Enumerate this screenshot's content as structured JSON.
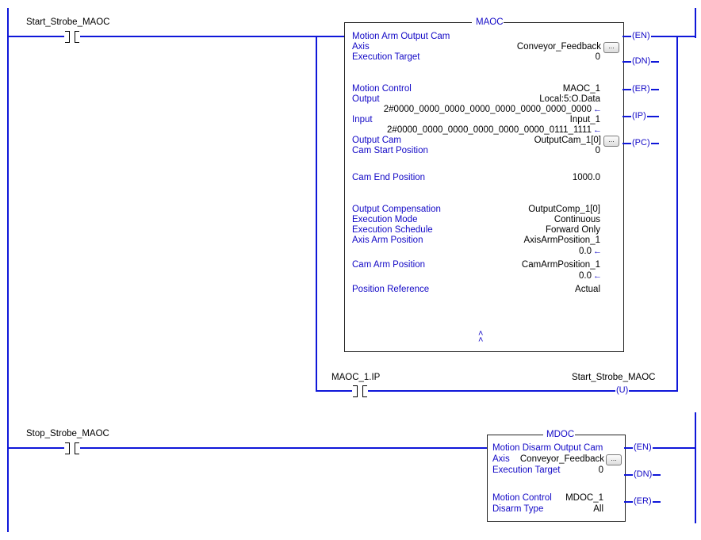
{
  "rung1": {
    "contact_tag": "Start_Strobe_MAOC",
    "branch_contact_tag": "MAOC_1.IP",
    "coil_tag": "Start_Strobe_MAOC",
    "coil_symbol": "U",
    "block": {
      "name": "MAOC",
      "description": "Motion Arm Output Cam",
      "rows": [
        {
          "label": "Axis",
          "value": "Conveyor_Feedback",
          "browse": true
        },
        {
          "label": "Execution Target",
          "value": "0"
        },
        {
          "label": "Motion Control",
          "value": "MAOC_1"
        },
        {
          "label": "Output",
          "value": "Local:5:O.Data"
        },
        {
          "label": "",
          "value": "2#0000_0000_0000_0000_0000_0000_0000_0000",
          "arrow": true
        },
        {
          "label": "Input",
          "value": "Input_1"
        },
        {
          "label": "",
          "value": "2#0000_0000_0000_0000_0000_0000_0111_1111",
          "arrow": true
        },
        {
          "label": "Output Cam",
          "value": "OutputCam_1[0]",
          "browse": true
        },
        {
          "label": "Cam Start Position",
          "value": "0"
        },
        {
          "label": "Cam End Position",
          "value": "1000.0"
        },
        {
          "label": "Output Compensation",
          "value": "OutputComp_1[0]"
        },
        {
          "label": "Execution Mode",
          "value": "Continuous"
        },
        {
          "label": "Execution Schedule",
          "value": "Forward Only"
        },
        {
          "label": "Axis Arm Position",
          "value": "AxisArmPosition_1"
        },
        {
          "label": "",
          "value": "0.0",
          "arrow": true
        },
        {
          "label": "Cam Arm Position",
          "value": "CamArmPosition_1"
        },
        {
          "label": "",
          "value": "0.0",
          "arrow": true
        },
        {
          "label": "Position Reference",
          "value": "Actual"
        }
      ],
      "collapse_glyph": "˄˄",
      "outputs": [
        "EN",
        "DN",
        "ER",
        "IP",
        "PC"
      ]
    }
  },
  "rung2": {
    "contact_tag": "Stop_Strobe_MAOC",
    "block": {
      "name": "MDOC",
      "description": "Motion Disarm Output Cam",
      "rows": [
        {
          "label": "Axis",
          "value": "Conveyor_Feedback",
          "browse": true
        },
        {
          "label": "Execution Target",
          "value": "0"
        },
        {
          "label": "Motion Control",
          "value": "MDOC_1"
        },
        {
          "label": "Disarm Type",
          "value": "All"
        }
      ],
      "outputs": [
        "EN",
        "DN",
        "ER"
      ]
    }
  },
  "icons": {
    "browse": "...",
    "arrow": "←"
  },
  "colors": {
    "wire": "#0f17d9",
    "label": "#1208c6"
  }
}
